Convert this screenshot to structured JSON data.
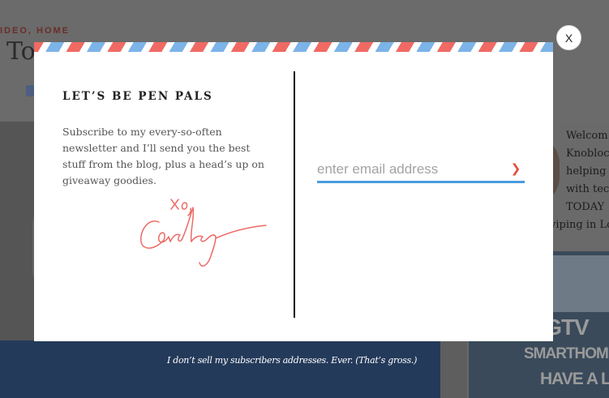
{
  "background": {
    "category_text": "IDEO, HOME",
    "title_fragment": "To",
    "sidebar_lines": [
      "Welcom",
      "Knobloc",
      "helping",
      "with tec",
      "TODAY",
      "viping in Lo"
    ],
    "ad": {
      "logo": "HGTV",
      "line1": "SMARTHOME",
      "line2": "HAVE A LO"
    }
  },
  "modal": {
    "heading": "LET’S BE PEN PALS",
    "description": "Subscribe to my every-so-often newsletter and I’ll send you the best stuff from the blog, plus a head’s up on giveaway goodies.",
    "signature": {
      "xo": "xo,",
      "name": "Carley"
    },
    "email_placeholder": "enter email address",
    "submit_icon": "chevron-right",
    "close_label": "X",
    "accent_colors": {
      "blue": "#7cb3e8",
      "red": "#f06a63",
      "underline": "#4a9be0",
      "arrow": "#e4503f"
    }
  },
  "disclaimer": "I don’t sell my subscribers addresses. Ever. (That’s gross.)"
}
